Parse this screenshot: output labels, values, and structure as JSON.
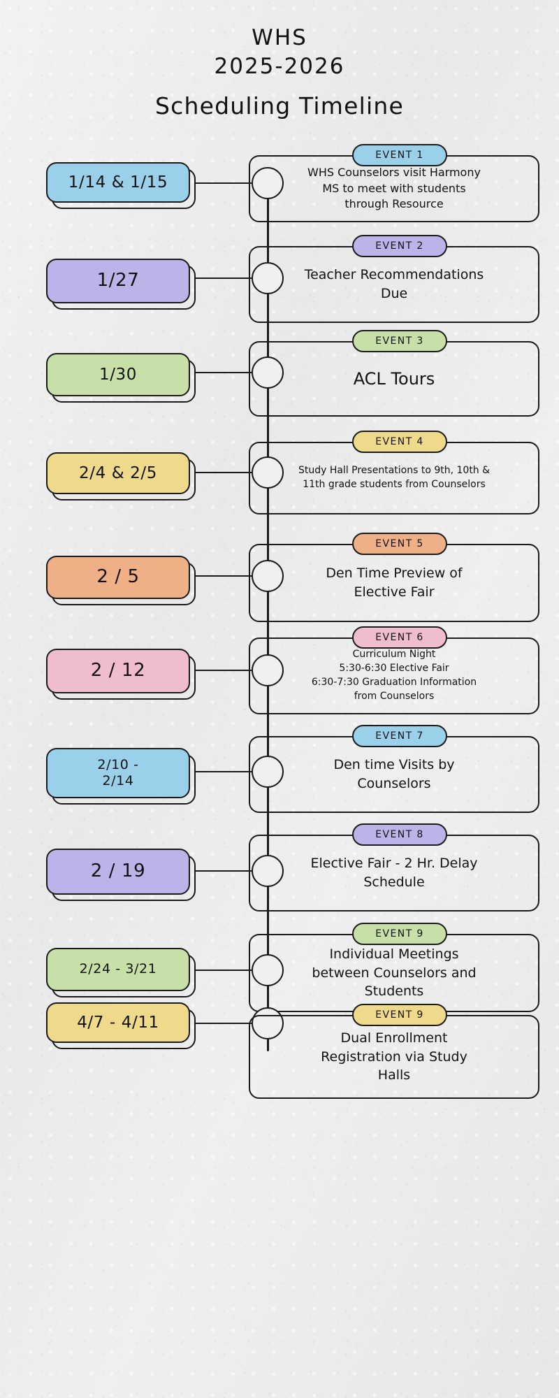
{
  "header": {
    "title_line1": "WHS",
    "title_line2": "2025-2026",
    "subtitle": "Scheduling Timeline"
  },
  "colors": {
    "blue": "#9BD0EA",
    "purple": "#BDB3E8",
    "green": "#C6E0A8",
    "yellow": "#EFD98B",
    "orange": "#F0B087",
    "pink": "#F0BCD0",
    "ink": "#1a1a1a",
    "paper": "#eceded"
  },
  "events": [
    {
      "date": "1/14 & 1/15",
      "pill_label": "EVENT 1",
      "color": "#9BD0EA",
      "text": "WHS Counselors visit Harmony\nMS to meet with students\nthrough Resource"
    },
    {
      "date": "1/27",
      "pill_label": "EVENT 2",
      "color": "#BDB3E8",
      "text": "Teacher Recommendations\nDue"
    },
    {
      "date": "1/30",
      "pill_label": "EVENT 3",
      "color": "#C6E0A8",
      "text": "ACL Tours"
    },
    {
      "date": "2/4 & 2/5",
      "pill_label": "EVENT 4",
      "color": "#EFD98B",
      "text": "Study Hall Presentations to 9th, 10th &\n11th grade students from Counselors"
    },
    {
      "date": "2 / 5",
      "pill_label": "EVENT 5",
      "color": "#F0B087",
      "text": "Den Time Preview of\nElective Fair"
    },
    {
      "date": "2 / 12",
      "pill_label": "EVENT 6",
      "color": "#F0BCD0",
      "text": "Curriculum Night\n5:30-6:30 Elective Fair\n6:30-7:30 Graduation Information\nfrom Counselors"
    },
    {
      "date": "2/10 -\n2/14",
      "pill_label": "EVENT 7",
      "color": "#9BD0EA",
      "text": "Den time Visits by\nCounselors"
    },
    {
      "date": "2 / 19",
      "pill_label": "EVENT 8",
      "color": "#BDB3E8",
      "text": "Elective Fair - 2 Hr. Delay\nSchedule"
    },
    {
      "date": "2/24 - 3/21",
      "pill_label": "EVENT 9",
      "color": "#C6E0A8",
      "text": "Individual Meetings\nbetween Counselors and\nStudents"
    },
    {
      "date": "4/7 - 4/11",
      "pill_label": "EVENT 9",
      "color": "#EFD98B",
      "text": "Dual Enrollment\nRegistration via Study\nHalls"
    }
  ]
}
